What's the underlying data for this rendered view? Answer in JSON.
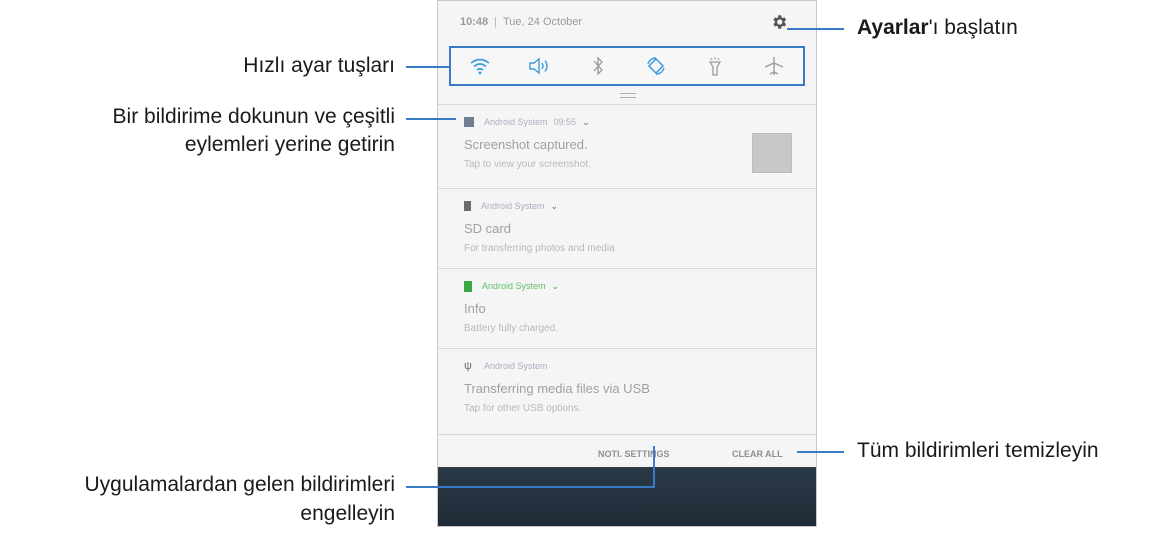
{
  "status_bar": {
    "time": "10:48",
    "date": "Tue, 24 October"
  },
  "quick_settings": [
    {
      "name": "wifi",
      "color": "#3b9be0"
    },
    {
      "name": "sound",
      "color": "#3b9be0"
    },
    {
      "name": "bluetooth",
      "color": "#9a9a9a"
    },
    {
      "name": "auto-rotate",
      "color": "#3b9be0"
    },
    {
      "name": "flashlight",
      "color": "#9a9a9a"
    },
    {
      "name": "airplane-mode",
      "color": "#9a9a9a"
    }
  ],
  "notifications": [
    {
      "app": "Android System",
      "time": "09:55",
      "title": "Screenshot captured.",
      "subtitle": "Tap to view your screenshot.",
      "icon": "image-icon"
    },
    {
      "app": "Android System",
      "time": "",
      "title": "SD card",
      "subtitle": "For transferring photos and media",
      "icon": "sd-card-icon"
    },
    {
      "app": "Android System",
      "time": "",
      "title": "Info",
      "subtitle": "Battery fully charged.",
      "icon": "battery-icon",
      "accent": "#3aa845"
    },
    {
      "app": "Android System",
      "time": "",
      "title": "Transferring media files via USB",
      "subtitle": "Tap for other USB options.",
      "icon": "usb-icon"
    }
  ],
  "bottom_bar": {
    "notif_settings": "NOTI. SETTINGS",
    "clear_all": "CLEAR ALL"
  },
  "callouts": {
    "settings_bold": "Ayarlar",
    "settings_rest": "'ı başlatın",
    "quick_settings": "Hızlı ayar tuşları",
    "tap_notification_line1": "Bir bildirime dokunun ve çeşitli",
    "tap_notification_line2": "eylemleri yerine getirin",
    "clear_all": "Tüm bildirimleri temizleyin",
    "block_line1": "Uygulamalardan gelen bildirimleri",
    "block_line2": "engelleyin"
  },
  "colors": {
    "callout": "#3a78c8",
    "accent_blue": "#3b9be0",
    "green": "#3aa845"
  }
}
